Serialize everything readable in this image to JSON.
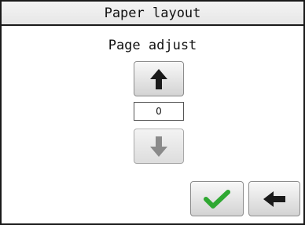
{
  "window": {
    "title": "Paper layout"
  },
  "main": {
    "heading": "Page adjust",
    "adjust_value": "0",
    "up_button": {
      "icon": "arrow-up-icon",
      "enabled": true
    },
    "down_button": {
      "icon": "arrow-down-icon",
      "enabled": false
    }
  },
  "footer": {
    "ok_button": {
      "icon": "checkmark-icon"
    },
    "back_button": {
      "icon": "arrow-left-icon"
    }
  },
  "colors": {
    "check_green": "#2fa832",
    "arrow_dark": "#1a1a1a",
    "arrow_disabled": "#8a8a8a"
  }
}
